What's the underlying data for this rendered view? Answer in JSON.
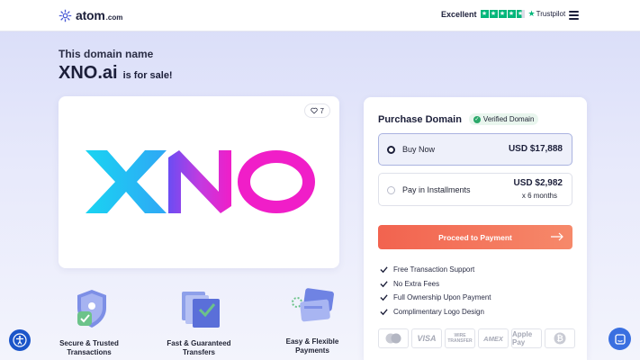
{
  "header": {
    "logo_text": "atom",
    "logo_suffix": ".com",
    "trust_rating": "Excellent",
    "trust_brand": "Trustpilot",
    "menu_icon": "hamburger-icon"
  },
  "listing": {
    "subtitle": "This domain name",
    "domain": "XNO.ai",
    "for_sale": "is for sale!",
    "likes": "7",
    "logo_wordmark": "XNO"
  },
  "features": [
    {
      "label_line1": "Secure & Trusted",
      "label_line2": "Transactions",
      "icon": "shield-check-icon"
    },
    {
      "label_line1": "Fast & Guaranteed",
      "label_line2": "Transfers",
      "icon": "transfer-folder-icon"
    },
    {
      "label_line1": "Easy & Flexible",
      "label_line2": "Payments",
      "icon": "credit-cards-icon"
    }
  ],
  "purchase": {
    "title": "Purchase Domain",
    "verified": "Verified Domain",
    "options": [
      {
        "label": "Buy Now",
        "price": "USD $17,888",
        "selected": true
      },
      {
        "label": "Pay in Installments",
        "price": "USD $2,982",
        "sub": "x 6 months",
        "selected": false
      }
    ],
    "cta": "Proceed to Payment",
    "benefits": [
      "Free Transaction Support",
      "No Extra Fees",
      "Full Ownership Upon Payment",
      "Complimentary Logo Design"
    ],
    "payment_methods": [
      "Mastercard",
      "VISA",
      "WIRE TRANSFER",
      "AMEX",
      "Apple Pay",
      "Bitcoin"
    ]
  },
  "colors": {
    "accent": "#f2634f",
    "brand": "#4a5bd6",
    "trust_green": "#00b67a",
    "xno_cyan": "#19d4f2",
    "xno_magenta": "#f01ec8"
  }
}
